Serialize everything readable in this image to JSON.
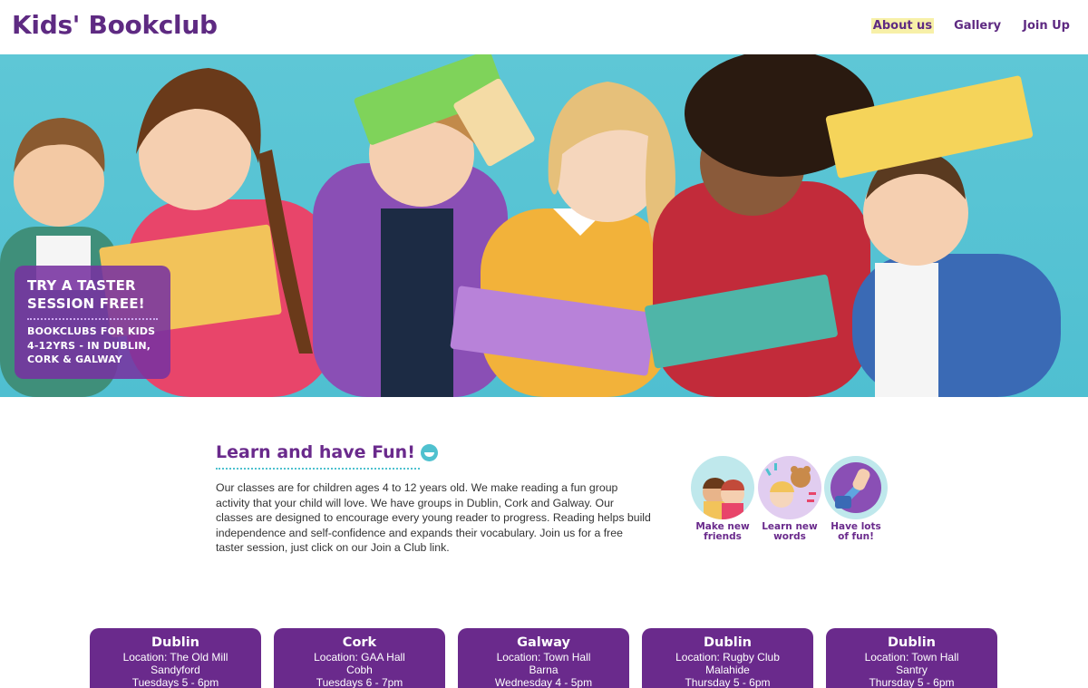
{
  "header": {
    "logo": "Kids' Bookclub",
    "nav": [
      {
        "label": "About us",
        "active": true
      },
      {
        "label": "Gallery",
        "active": false
      },
      {
        "label": "Join Up",
        "active": false
      }
    ]
  },
  "hero": {
    "promo_title": "TRY A TASTER SESSION FREE!",
    "promo_subtitle": "BOOKCLUBS FOR KIDS 4-12YRS - IN DUBLIN, CORK & GALWAY"
  },
  "intro": {
    "title": "Learn and have Fun!",
    "title_icon": "smile-emoji-icon",
    "text": "Our classes are for children ages 4 to 12 years old. We make reading a fun group activity that your child will love. We have groups in Dublin, Cork and Galway. Our classes are designed to encourage every young reader to progress. Reading helps build independence and self-confidence and expands their vocabulary. Join us for a free taster session, just click on our Join a Club link."
  },
  "features": [
    {
      "label": "Make new friends",
      "icon": "friends-icon"
    },
    {
      "label": "Learn new words",
      "icon": "words-icon"
    },
    {
      "label": "Have lots of fun!",
      "icon": "fun-icon"
    }
  ],
  "locations": [
    {
      "city": "Dublin",
      "location": "Location: The Old Mill",
      "area": "Sandyford",
      "time": "Tuesdays 5 - 6pm"
    },
    {
      "city": "Cork",
      "location": "Location: GAA Hall",
      "area": "Cobh",
      "time": "Tuesdays 6 - 7pm"
    },
    {
      "city": "Galway",
      "location": "Location: Town Hall",
      "area": "Barna",
      "time": "Wednesday 4 - 5pm"
    },
    {
      "city": "Dublin",
      "location": "Location: Rugby Club",
      "area": "Malahide",
      "time": "Thursday 5 - 6pm"
    },
    {
      "city": "Dublin",
      "location": "Location: Town Hall",
      "area": "Santry",
      "time": "Thursday 5 - 6pm"
    }
  ],
  "colors": {
    "brand_purple": "#6a2a8c",
    "accent_teal": "#4fc1cf",
    "nav_highlight": "#f7f0a8"
  }
}
